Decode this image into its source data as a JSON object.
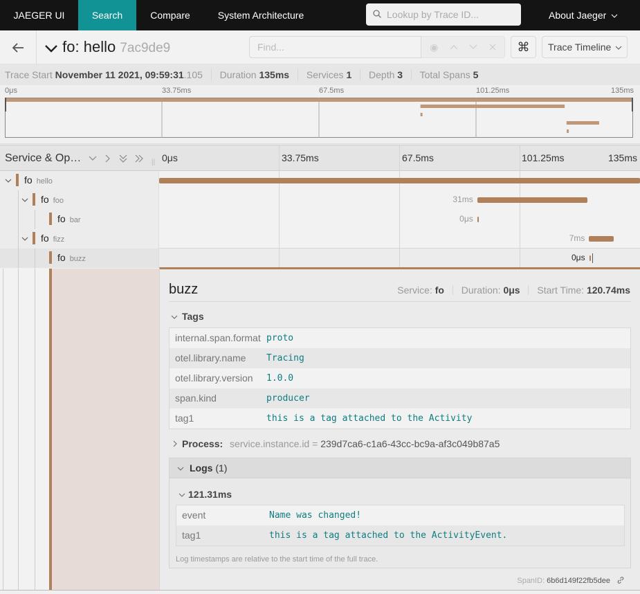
{
  "nav": {
    "logo": "JAEGER UI",
    "tabs": [
      {
        "label": "Search",
        "active": true
      },
      {
        "label": "Compare",
        "active": false
      },
      {
        "label": "System Architecture",
        "active": false
      }
    ],
    "lookup_placeholder": "Lookup by Trace ID...",
    "about": "About Jaeger",
    "accent": "#119294"
  },
  "header": {
    "service": "fo:",
    "operation": "hello",
    "trace_id_short": "7ac9de9",
    "find_placeholder": "Find...",
    "kbd_icon": "⌘",
    "view_selector": "Trace Timeline"
  },
  "summary": {
    "trace_start_label": "Trace Start",
    "trace_start": "November 11 2021, 09:59:31",
    "trace_start_ms": ".105",
    "duration_label": "Duration",
    "duration": "135ms",
    "services_label": "Services",
    "services": "1",
    "depth_label": "Depth",
    "depth": "3",
    "total_spans_label": "Total Spans",
    "total_spans": "5"
  },
  "ticks": [
    "0μs",
    "33.75ms",
    "67.5ms",
    "101.25ms",
    "135ms"
  ],
  "trace_duration_ms": 135,
  "span_color": "#b08058",
  "timeline_header": {
    "title": "Service & Op…"
  },
  "spans": [
    {
      "service": "fo",
      "operation": "hello",
      "depth": 0,
      "start_ms": 0,
      "duration_ms": 135,
      "label": "",
      "collapsible": true
    },
    {
      "service": "fo",
      "operation": "foo",
      "depth": 1,
      "start_ms": 89.3,
      "duration_ms": 31,
      "label": "31ms",
      "collapsible": true
    },
    {
      "service": "fo",
      "operation": "bar",
      "depth": 2,
      "start_ms": 89.3,
      "duration_ms": 0,
      "label": "0μs",
      "collapsible": false
    },
    {
      "service": "fo",
      "operation": "fizz",
      "depth": 1,
      "start_ms": 120.7,
      "duration_ms": 7,
      "label": "7ms",
      "collapsible": true
    },
    {
      "service": "fo",
      "operation": "buzz",
      "depth": 2,
      "start_ms": 120.74,
      "duration_ms": 0,
      "label": "0μs",
      "collapsible": false,
      "selected": true
    }
  ],
  "detail": {
    "operation": "buzz",
    "service_label": "Service:",
    "service": "fo",
    "duration_label": "Duration:",
    "duration": "0μs",
    "start_label": "Start Time:",
    "start": "120.74ms",
    "tags_label": "Tags",
    "tags": [
      {
        "key": "internal.span.format",
        "value": "proto"
      },
      {
        "key": "otel.library.name",
        "value": "Tracing"
      },
      {
        "key": "otel.library.version",
        "value": "1.0.0"
      },
      {
        "key": "span.kind",
        "value": "producer"
      },
      {
        "key": "tag1",
        "value": "this is a tag attached to the Activity"
      }
    ],
    "process_label": "Process:",
    "process_key": "service.instance.id",
    "process_value": "239d7ca6-c1a6-43cc-bc9a-af3c049b87a5",
    "logs_label": "Logs",
    "logs_count": "(1)",
    "log_timestamp": "121.31ms",
    "log_fields": [
      {
        "key": "event",
        "value": "Name was changed!"
      },
      {
        "key": "tag1",
        "value": "this is a tag attached to the ActivityEvent."
      }
    ],
    "logs_note": "Log timestamps are relative to the start time of the full trace.",
    "span_id_label": "SpanID:",
    "span_id": "6b6d149f22fb5dee"
  }
}
